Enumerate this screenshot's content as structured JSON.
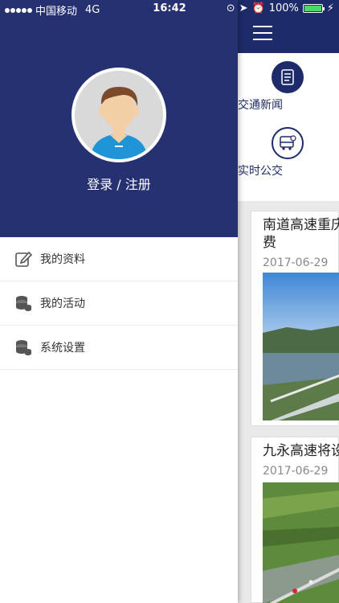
{
  "status": {
    "carrier": "中国移动",
    "network": "4G",
    "time": "16:42",
    "battery": "100%"
  },
  "drawer": {
    "login_label": "登录 / 注册",
    "items": [
      {
        "label": "我的资料",
        "icon": "edit-icon"
      },
      {
        "label": "我的活动",
        "icon": "stack-icon"
      },
      {
        "label": "系统设置",
        "icon": "stack-icon"
      }
    ]
  },
  "app": {
    "shortcuts": [
      {
        "label": "交通新闻",
        "icon": "news-icon"
      },
      {
        "label": "实时公交",
        "icon": "bus-icon"
      }
    ],
    "news": [
      {
        "title": "南道高速重庆",
        "title2": "费",
        "date": "2017-06-29"
      },
      {
        "title": "九永高速将设",
        "date": "2017-06-29"
      }
    ]
  }
}
